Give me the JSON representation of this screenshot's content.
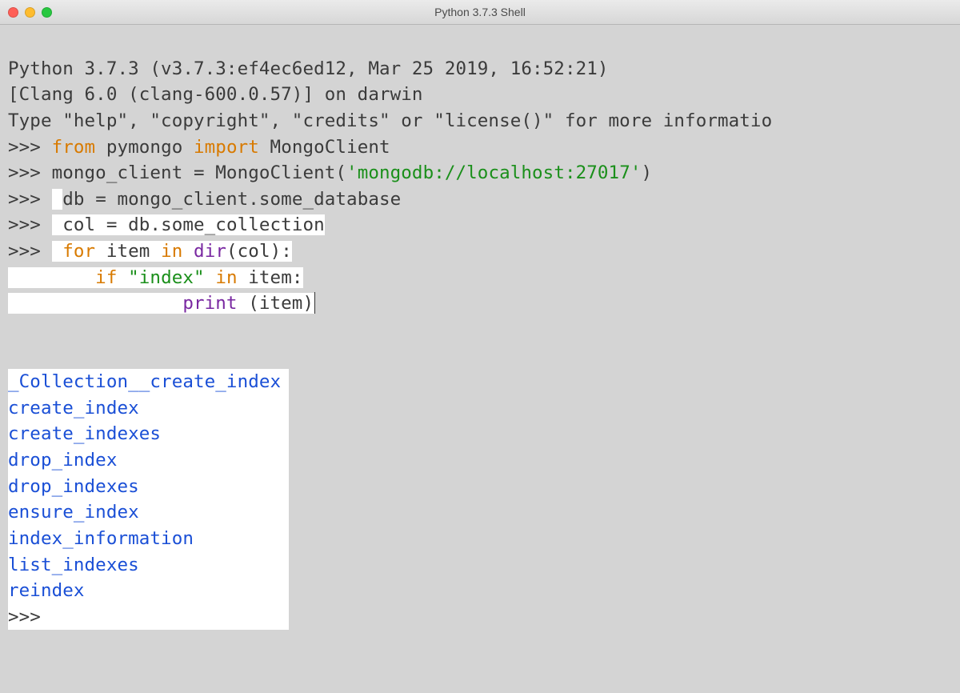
{
  "window": {
    "title": "Python 3.7.3 Shell"
  },
  "banner": {
    "line1": "Python 3.7.3 (v3.7.3:ef4ec6ed12, Mar 25 2019, 16:52:21)",
    "line2": "[Clang 6.0 (clang-600.0.57)] on darwin",
    "line3": "Type \"help\", \"copyright\", \"credits\" or \"license()\" for more informatio"
  },
  "prompts": {
    "primary": ">>> ",
    "continuation": ""
  },
  "code": {
    "l1": {
      "kw1": "from",
      "mid1": " pymongo ",
      "kw2": "import",
      "mid2": " MongoClient"
    },
    "l2": {
      "pre": "mongo_client = MongoClient(",
      "str": "'mongodb://localhost:27017'",
      "post": ")"
    },
    "l3": {
      "pre_sp": " ",
      "text": "db = mongo_client.some_database"
    },
    "l4": {
      "pre_sp": " ",
      "text": "col = db.some_collection"
    },
    "l5": {
      "pre_sp": " ",
      "kw_for": "for",
      "mid1": " item ",
      "kw_in": "in",
      "sp": " ",
      "builtin": "dir",
      "post": "(col):"
    },
    "l6": {
      "indent": "        ",
      "kw_if": "if",
      "sp1": " ",
      "str": "\"index\"",
      "sp2": " ",
      "kw_in": "in",
      "post": " item:"
    },
    "l7": {
      "indent": "                ",
      "builtin": "print",
      "post": " (item)"
    }
  },
  "output": {
    "items": [
      "_Collection__create_index",
      "create_index",
      "create_indexes",
      "drop_index",
      "drop_indexes",
      "ensure_index",
      "index_information",
      "list_indexes",
      "reindex"
    ]
  },
  "final_prompt": ">>> "
}
